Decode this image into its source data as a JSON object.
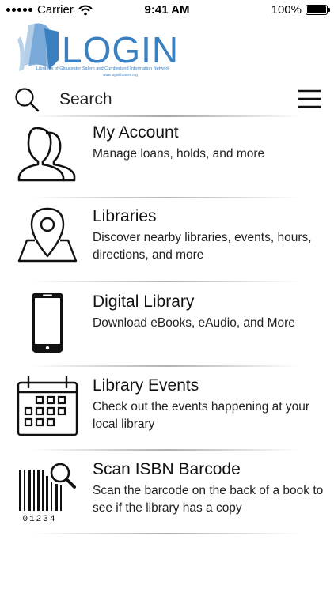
{
  "status_bar": {
    "carrier": "Carrier",
    "time": "9:41 AM",
    "battery": "100%"
  },
  "logo": {
    "word": "LOGIN",
    "tagline": "Libraries of Gloucester Salem and Cumberland Information Network",
    "url": "www.loginlibraries.org",
    "color": "#3a7fc0"
  },
  "search": {
    "label": "Search",
    "icon": "search-icon",
    "menu_icon": "hamburger-menu-icon"
  },
  "menu": {
    "items": [
      {
        "title": "My Account",
        "description": "Manage loans, holds, and more",
        "icon": "users-icon"
      },
      {
        "title": "Libraries",
        "description": "Discover nearby libraries, events, hours, directions, and more",
        "icon": "map-pin-icon"
      },
      {
        "title": "Digital Library",
        "description": "Download eBooks, eAudio, and More",
        "icon": "phone-icon"
      },
      {
        "title": "Library Events",
        "description": "Check out the events happening at your local library",
        "icon": "calendar-icon"
      },
      {
        "title": "Scan ISBN Barcode",
        "description": "Scan the barcode on the back of a book to see if the library has a copy",
        "icon": "barcode-icon",
        "barcode_digits": "01234"
      }
    ]
  }
}
